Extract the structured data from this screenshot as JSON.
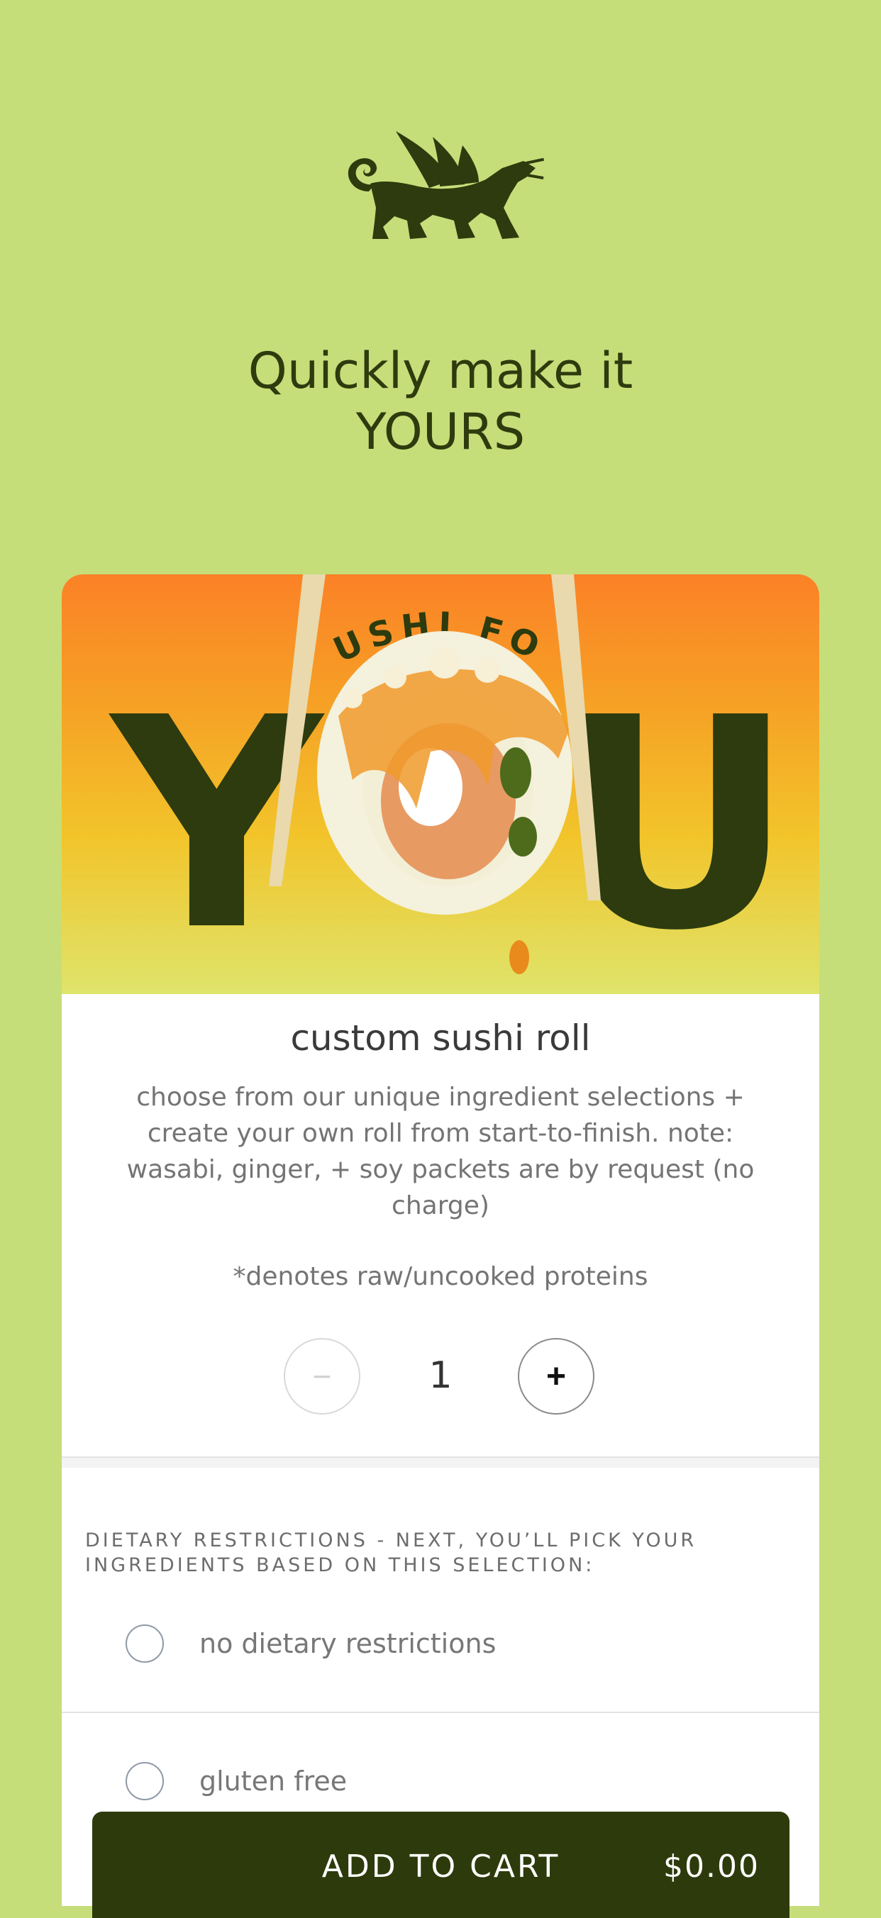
{
  "brand": {
    "logo_icon": "winged-tiger-icon",
    "colors": {
      "background": "#c5de79",
      "dark": "#2d3a0b",
      "hero_top": "#fb8126",
      "hero_bottom": "#dfe46b"
    }
  },
  "header": {
    "headline_line1": "Quickly make it",
    "headline_line2": "YOURS"
  },
  "hero": {
    "arc_text": "SUSHI FOR",
    "big_left": "Y",
    "big_right": "U"
  },
  "product": {
    "title": "custom sushi roll",
    "description": "choose from our unique ingredient selections + create your own roll from start-to-finish. note: wasabi, ginger, + soy packets are by request (no charge)",
    "raw_note": "*denotes raw/uncooked proteins"
  },
  "quantity": {
    "minus_label": "−",
    "value": "1",
    "plus_label": "+"
  },
  "dietary": {
    "heading": "DIETARY RESTRICTIONS - NEXT, YOU’LL PICK YOUR INGREDIENTS BASED ON THIS SELECTION:",
    "options": [
      {
        "label": "no dietary restrictions"
      },
      {
        "label": "gluten free"
      }
    ]
  },
  "cart": {
    "label": "ADD TO CART",
    "price": "$0.00"
  }
}
